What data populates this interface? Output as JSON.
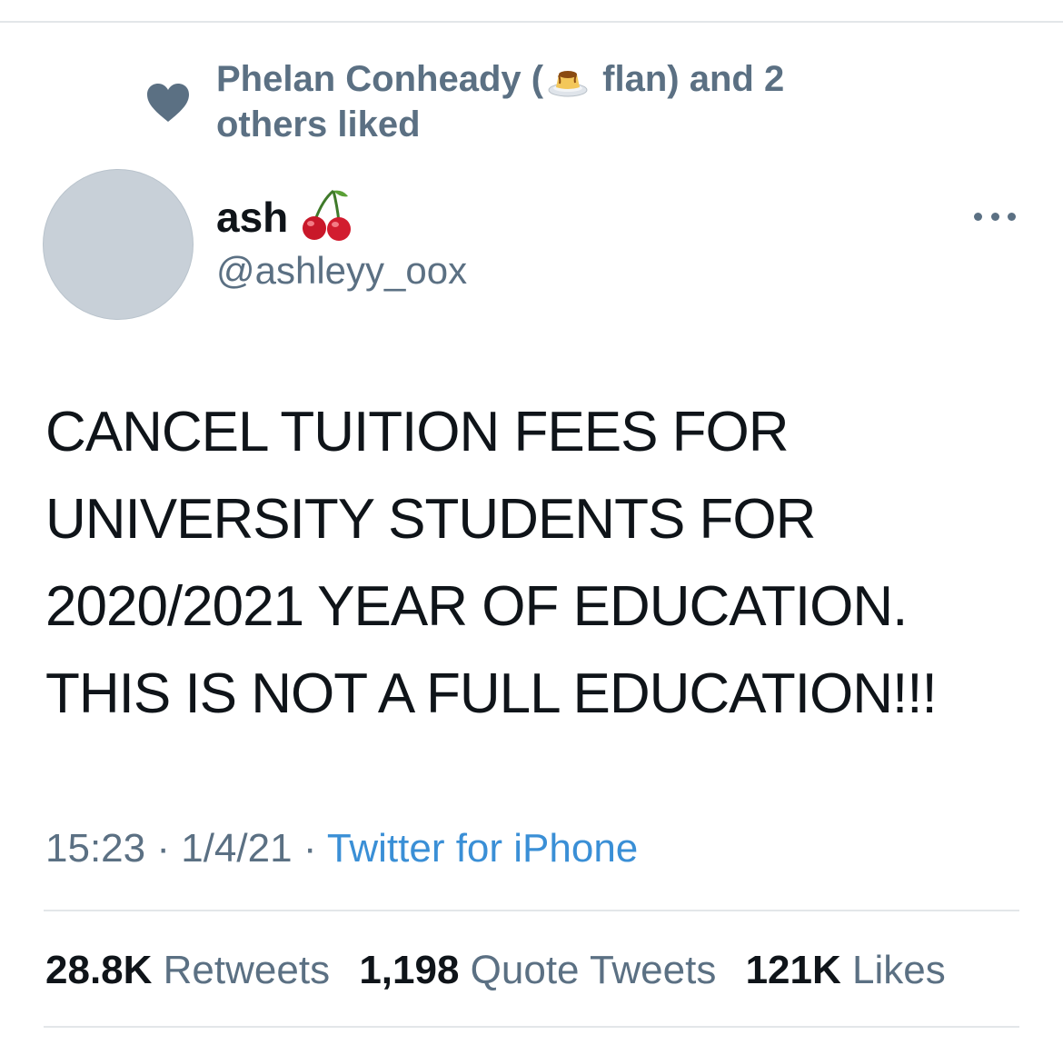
{
  "social_context": {
    "text_before": "Phelan Conheady (",
    "text_after": " flan) and 2 others liked",
    "heart_icon": "heart-icon",
    "flan_icon": "flan-emoji-icon"
  },
  "author": {
    "display_name": "ash",
    "handle": "@ashleyy_oox",
    "name_emoji": "cherries-emoji-icon",
    "avatar_color": "#c8d0d8"
  },
  "tweet": {
    "paragraphs": [
      "CANCEL TUITION FEES FOR UNIVERSITY STUDENTS FOR 2020/2021 YEAR OF EDUCATION.",
      "THIS IS NOT A FULL EDUCATION!!!"
    ],
    "time": "15:23",
    "date": "1/4/21",
    "separator": "·",
    "source": "Twitter for iPhone"
  },
  "stats": {
    "retweets_count": "28.8K",
    "retweets_label": "Retweets",
    "quotes_count": "1,198",
    "quotes_label": "Quote Tweets",
    "likes_count": "121K",
    "likes_label": "Likes"
  },
  "colors": {
    "secondary_text": "#5b7083",
    "link": "#3a8fd6",
    "primary_text": "#0f1419",
    "divider": "#e3e6e9"
  }
}
